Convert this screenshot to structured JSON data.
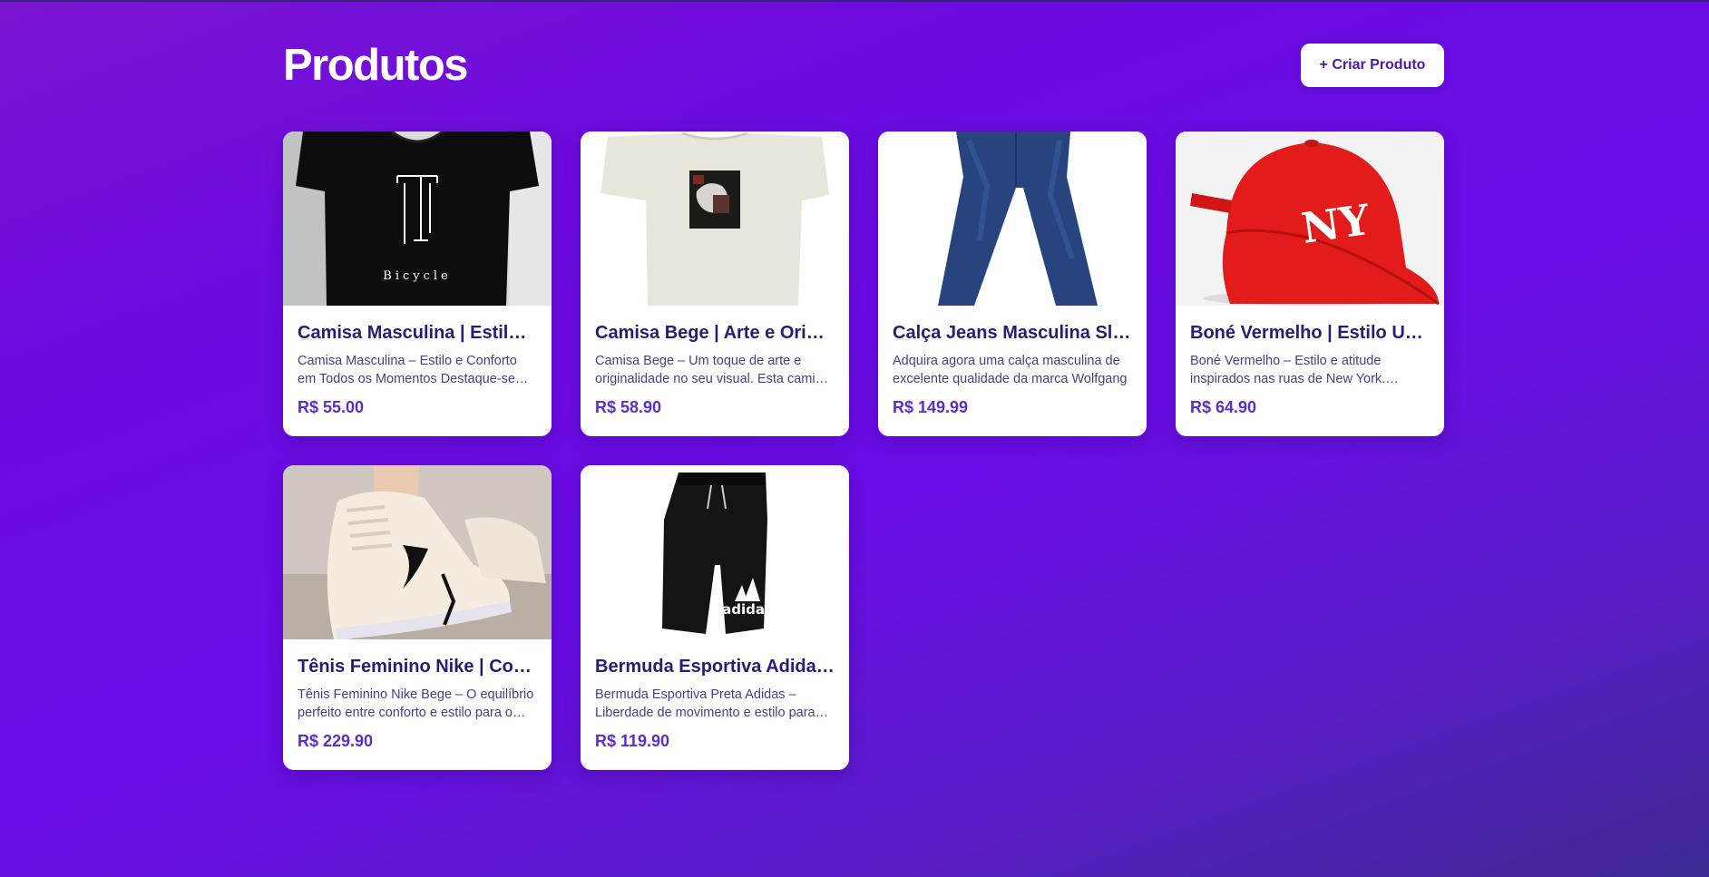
{
  "page": {
    "title": "Produtos",
    "create_button_label": "+ Criar Produto"
  },
  "products": [
    {
      "title": "Camisa Masculina | Estilo e Conforto",
      "description": "Camisa Masculina – Estilo e Conforto em Todos os Momentos Destaque-se com estilo e conforto",
      "price": "R$ 55.00",
      "image": "black-tshirt-bicycle-image",
      "image_text": "Bicycle"
    },
    {
      "title": "Camisa Bege | Arte e Originalidade",
      "description": "Camisa Bege – Um toque de arte e originalidade no seu visual. Esta camisa é ideal",
      "price": "R$ 58.90",
      "image": "beige-tshirt-art-print-image"
    },
    {
      "title": "Calça Jeans Masculina Slim Wolfgang",
      "description": "Adquira agora uma calça masculina de excelente qualidade da marca Wolfgang",
      "price": "R$ 149.99",
      "image": "blue-jeans-image"
    },
    {
      "title": "Boné Vermelho | Estilo Urbano NY",
      "description": "Boné Vermelho – Estilo e atitude inspirados nas ruas de New York. Perfeito para o dia a dia",
      "price": "R$ 64.90",
      "image": "red-ny-cap-image",
      "image_text": "NY"
    },
    {
      "title": "Tênis Feminino Nike | Conforto e Estilo",
      "description": "Tênis Feminino Nike Bege – O equilíbrio perfeito entre conforto e estilo para o seu dia",
      "price": "R$ 229.90",
      "image": "beige-nike-sneaker-image"
    },
    {
      "title": "Bermuda Esportiva Adidas Preta",
      "description": "Bermuda Esportiva Preta Adidas – Liberdade de movimento e estilo para seus treinos",
      "price": "R$ 119.90",
      "image": "black-adidas-shorts-image",
      "image_text": "adidas"
    }
  ]
}
